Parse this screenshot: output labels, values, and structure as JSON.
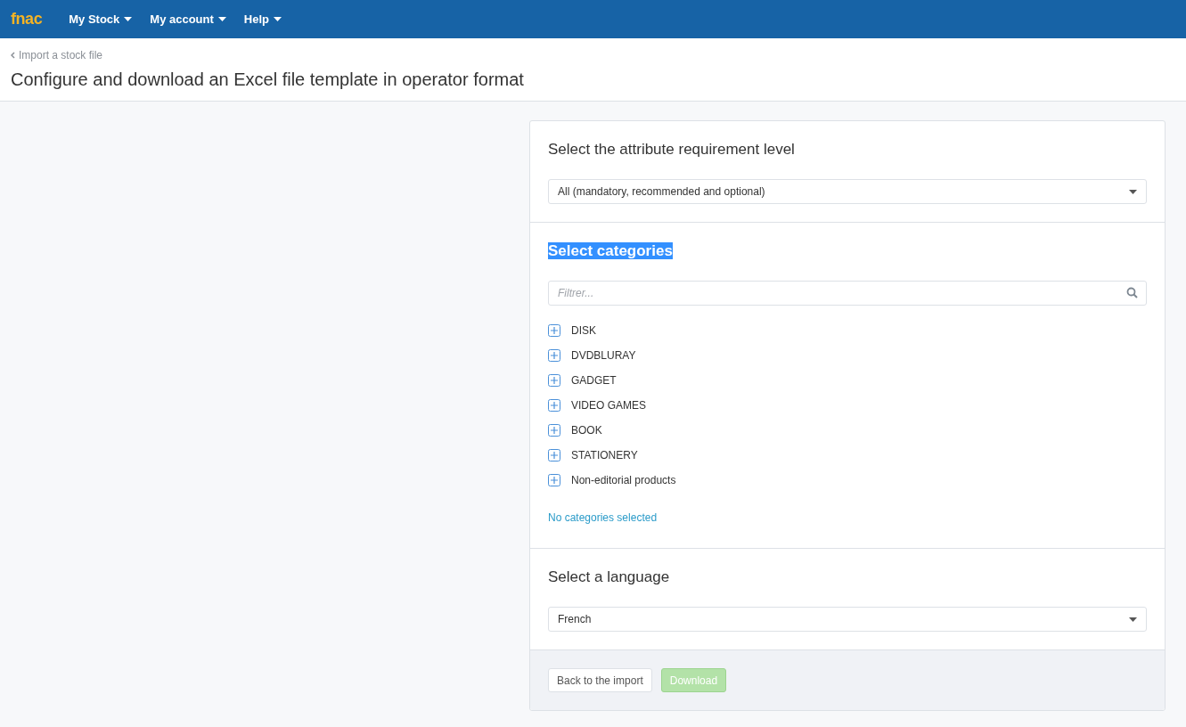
{
  "navbar": {
    "logo": "fnac",
    "menus": [
      {
        "label": "My Stock"
      },
      {
        "label": "My account"
      },
      {
        "label": "Help"
      }
    ]
  },
  "breadcrumb": {
    "back_link": "Import a stock file"
  },
  "page_title": "Configure and download an Excel file template in operator format",
  "requirement_section": {
    "title": "Select the attribute requirement level",
    "select_value": "All (mandatory, recommended and optional)"
  },
  "categories_section": {
    "title": "Select categories",
    "title_text_selected": true,
    "filter": {
      "placeholder": "Filtrer..."
    },
    "tree": [
      {
        "label": "DISK",
        "expanded": false
      },
      {
        "label": "DVDBLURAY",
        "expanded": false
      },
      {
        "label": "GADGET",
        "expanded": false
      },
      {
        "label": "VIDEO GAMES",
        "expanded": false
      },
      {
        "label": "BOOK",
        "expanded": false
      },
      {
        "label": "STATIONERY",
        "expanded": false
      },
      {
        "label": "Non-editorial products",
        "expanded": false
      }
    ],
    "selection_status": "No categories selected"
  },
  "language_section": {
    "title": "Select a language",
    "select_value": "French"
  },
  "footer_buttons": [
    {
      "label": "Back to the import",
      "kind": "secondary",
      "disabled": false
    },
    {
      "label": "Download",
      "kind": "primary",
      "disabled": true
    }
  ]
}
